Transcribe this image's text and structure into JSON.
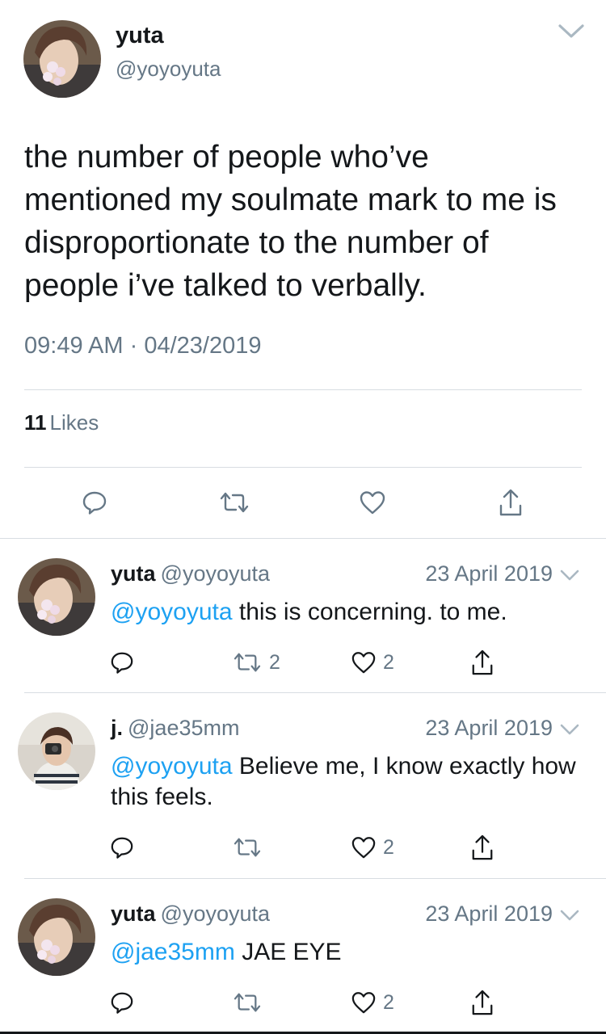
{
  "main_tweet": {
    "name": "yuta",
    "handle": "@yoyoyuta",
    "text": "the number of people who’ve mentioned my soulmate mark to me is disproportionate to the number of people i’ve talked to verbally.",
    "time": "09:49 AM",
    "date": "04/23/2019",
    "likes_count": "11",
    "likes_label": "Likes"
  },
  "replies": [
    {
      "name": "yuta",
      "handle": "@yoyoyuta",
      "date": "23 April 2019",
      "mention": "@yoyoyuta",
      "text": "this is concerning. to me.",
      "retweets": "2",
      "likes": "2"
    },
    {
      "name": "j.",
      "handle": "@jae35mm",
      "date": "23 April 2019",
      "mention": "@yoyoyuta",
      "text": "Believe me, I know exactly how this feels.",
      "retweets": "",
      "likes": "2"
    },
    {
      "name": "yuta",
      "handle": "@yoyoyuta",
      "date": "23 April 2019",
      "mention": "@jae35mm",
      "text": "JAE EYE",
      "retweets": "",
      "likes": "2"
    }
  ],
  "icons": {
    "reply": "reply-icon",
    "retweet": "retweet-icon",
    "like": "heart-icon",
    "share": "share-icon",
    "caret": "chevron-down-icon"
  },
  "colors": {
    "text": "#14171a",
    "secondary": "#657786",
    "link": "#1da1f2",
    "divider": "#d8dde2"
  }
}
